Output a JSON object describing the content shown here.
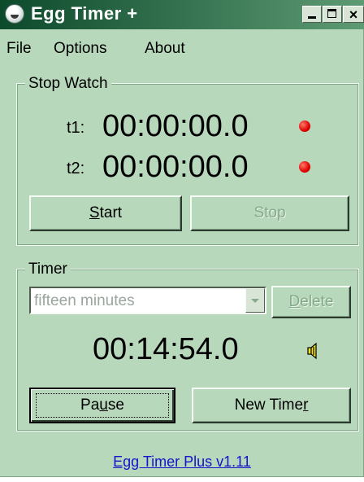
{
  "window": {
    "title": "Egg Timer +",
    "colors": {
      "background": "#b7d8bb",
      "titlebar_start": "#0c4a2c",
      "titlebar_end": "#5e9a73",
      "link": "#1414cc",
      "indicator": "#e00000"
    }
  },
  "menu": {
    "items": [
      {
        "label": "File"
      },
      {
        "label": "Options"
      },
      {
        "label": "About"
      }
    ]
  },
  "stopwatch": {
    "group_label": "Stop Watch",
    "t1": {
      "label": "t1:",
      "value": "00:00:00.0",
      "indicator": "red"
    },
    "t2": {
      "label": "t2:",
      "value": "00:00:00.0",
      "indicator": "red"
    },
    "start_button": {
      "mnemonic": "S",
      "rest": "tart",
      "enabled": true
    },
    "stop_button": {
      "label": "Stop",
      "enabled": false
    }
  },
  "timer": {
    "group_label": "Timer",
    "preset": {
      "selected": "fifteen minutes",
      "enabled": false
    },
    "delete_button": {
      "mnemonic": "D",
      "rest": "elete",
      "enabled": false
    },
    "value": "00:14:54.0",
    "sound_icon": "speaker-icon",
    "pause_button": {
      "before": "Pa",
      "mnemonic": "u",
      "after": "se",
      "default": true
    },
    "new_timer_button": {
      "before": "New Time",
      "mnemonic": "r"
    }
  },
  "footer": {
    "link_text": "Egg Timer Plus v1.11"
  }
}
